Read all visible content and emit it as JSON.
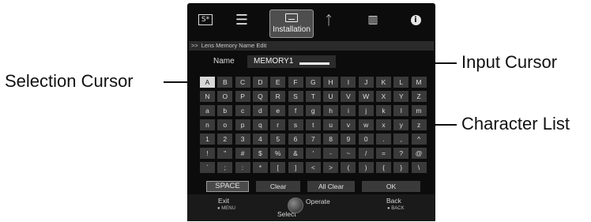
{
  "callouts": {
    "selection_cursor": "Selection Cursor",
    "input_cursor": "Input Cursor",
    "character_list": "Character List"
  },
  "menu": {
    "tabs": [
      {
        "icon": "picture-icon",
        "glyph": "S*",
        "label": ""
      },
      {
        "icon": "settings-sliders-icon",
        "glyph": "☰",
        "label": ""
      },
      {
        "icon": "installation-icon",
        "glyph": "",
        "label": "Installation"
      },
      {
        "icon": "wrench-icon",
        "glyph": "ᛏ",
        "label": ""
      },
      {
        "icon": "display-icon",
        "glyph": "▥",
        "label": ""
      },
      {
        "icon": "info-icon",
        "glyph": "i",
        "label": ""
      }
    ],
    "breadcrumb_arrows": ">>",
    "breadcrumb": "Lens Memory Name Edit",
    "name_label": "Name",
    "name_value": "MEMORY1",
    "rows": [
      [
        "A",
        "B",
        "C",
        "D",
        "E",
        "F",
        "G",
        "H",
        "I",
        "J",
        "K",
        "L",
        "M"
      ],
      [
        "N",
        "O",
        "P",
        "Q",
        "R",
        "S",
        "T",
        "U",
        "V",
        "W",
        "X",
        "Y",
        "Z"
      ],
      [
        "a",
        "b",
        "c",
        "d",
        "e",
        "f",
        "g",
        "h",
        "i",
        "j",
        "k",
        "l",
        "m"
      ],
      [
        "n",
        "o",
        "p",
        "q",
        "r",
        "s",
        "t",
        "u",
        "v",
        "w",
        "x",
        "y",
        "z"
      ],
      [
        "1",
        "2",
        "3",
        "4",
        "5",
        "6",
        "7",
        "8",
        "9",
        "0",
        ".",
        ",",
        "^"
      ],
      [
        "!",
        "\"",
        "#",
        "$",
        "%",
        "&",
        "'",
        "-",
        "~",
        "/",
        "=",
        "?",
        "@"
      ],
      [
        "`",
        ";",
        ":",
        "*",
        "[",
        "]",
        "<",
        ">",
        "(",
        ")",
        "{",
        "}",
        "\\"
      ]
    ],
    "selected_char": "A",
    "buttons": {
      "space": "SPACE",
      "clear": "Clear",
      "all_clear": "All Clear",
      "ok": "OK"
    },
    "footer": {
      "exit": "Exit",
      "exit_sub": "● MENU",
      "select": "Select",
      "operate": "Operate",
      "back": "Back",
      "back_sub": "● BACK"
    }
  }
}
